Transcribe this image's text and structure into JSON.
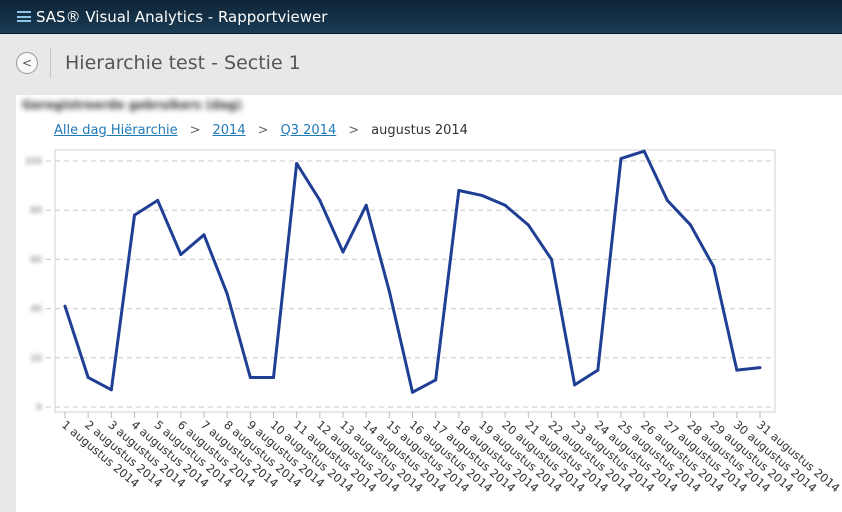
{
  "app": {
    "title": "SAS® Visual Analytics - Rapportviewer"
  },
  "page": {
    "title": "Hierarchie test - Sectie 1",
    "back_icon": "chevron-left-icon"
  },
  "breadcrumb": {
    "items": [
      "Alle dag Hiërarchie",
      "2014",
      "Q3 2014"
    ],
    "current": "augustus 2014"
  },
  "chart_data": {
    "type": "line",
    "title": "Geregistreerde gebruikers (dag)",
    "ylim": [
      0,
      100
    ],
    "yticks": [
      "0",
      "20",
      "40",
      "60",
      "80",
      "100"
    ],
    "grid": true,
    "color": "#1f3f94",
    "categories": [
      "1 augustus 2014",
      "2 augustus 2014",
      "3 augustus 2014",
      "4 augustus 2014",
      "5 augustus 2014",
      "6 augustus 2014",
      "7 augustus 2014",
      "8 augustus 2014",
      "9 augustus 2014",
      "10 augustus 2014",
      "11 augustus 2014",
      "12 augustus 2014",
      "13 augustus 2014",
      "14 augustus 2014",
      "15 augustus 2014",
      "16 augustus 2014",
      "17 augustus 2014",
      "18 augustus 2014",
      "19 augustus 2014",
      "20 augustus 2014",
      "21 augustus 2014",
      "22 augustus 2014",
      "23 augustus 2014",
      "24 augustus 2014",
      "25 augustus 2014",
      "26 augustus 2014",
      "27 augustus 2014",
      "28 augustus 2014",
      "29 augustus 2014",
      "30 augustus 2014",
      "31 augustus 2014"
    ],
    "values": [
      41,
      12,
      7,
      78,
      84,
      62,
      70,
      46,
      12,
      12,
      99,
      84,
      63,
      82,
      47,
      6,
      11,
      88,
      86,
      82,
      74,
      60,
      9,
      15,
      101,
      104,
      84,
      74,
      57,
      15,
      16
    ]
  }
}
